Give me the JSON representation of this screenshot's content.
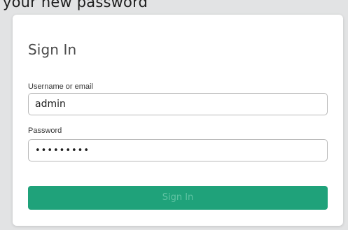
{
  "background": {
    "partial_text": "your new password"
  },
  "form": {
    "title": "Sign In",
    "username": {
      "label": "Username or email",
      "value": "admin"
    },
    "password": {
      "label": "Password",
      "masked_value": "•••••••••"
    },
    "submit_label": "Sign In"
  },
  "colors": {
    "accent": "#1fa27a",
    "page_bg": "#e2e3e4",
    "card_bg": "#ffffff"
  }
}
